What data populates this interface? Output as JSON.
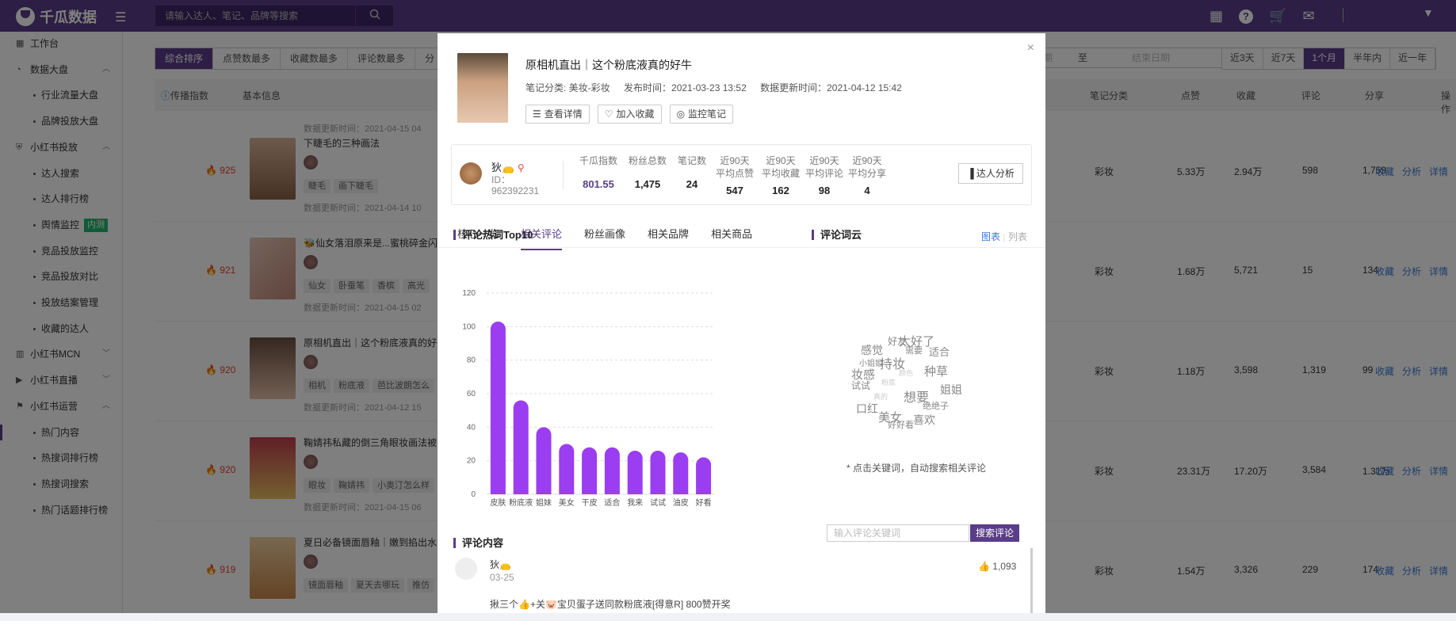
{
  "topbar": {
    "brand": "千瓜数据",
    "search_placeholder": "请输入达人、笔记、品牌等搜索"
  },
  "sidebar": {
    "items": [
      {
        "label": "工作台",
        "level": 1,
        "icon": "grid-icon"
      },
      {
        "label": "数据大盘",
        "level": 1,
        "icon": "pie-icon",
        "expanded": true
      },
      {
        "label": "行业流量大盘",
        "level": 2
      },
      {
        "label": "品牌投放大盘",
        "level": 2
      },
      {
        "label": "小红书投放",
        "level": 1,
        "icon": "shield-icon",
        "expanded": true
      },
      {
        "label": "达人搜索",
        "level": 2
      },
      {
        "label": "达人排行榜",
        "level": 2
      },
      {
        "label": "舆情监控",
        "level": 2,
        "badge": "内测"
      },
      {
        "label": "竞品投放监控",
        "level": 2
      },
      {
        "label": "竞品投放对比",
        "level": 2
      },
      {
        "label": "投放结案管理",
        "level": 2
      },
      {
        "label": "收藏的达人",
        "level": 2
      },
      {
        "label": "小红书MCN",
        "level": 1,
        "icon": "chart-icon",
        "expanded": false
      },
      {
        "label": "小红书直播",
        "level": 1,
        "icon": "video-icon",
        "expanded": false
      },
      {
        "label": "小红书运营",
        "level": 1,
        "icon": "bookmark-icon",
        "expanded": true
      },
      {
        "label": "热门内容",
        "level": 2,
        "active": true
      },
      {
        "label": "热搜词排行榜",
        "level": 2
      },
      {
        "label": "热搜词搜索",
        "level": 2
      },
      {
        "label": "热门话题排行榜",
        "level": 2
      }
    ]
  },
  "list": {
    "sort_tabs": [
      "综合排序",
      "点赞数最多",
      "收藏数最多",
      "评论数最多",
      "分"
    ],
    "date_start": "日期",
    "date_sep": "至",
    "date_end": "结束日期",
    "range_tabs": [
      "近3天",
      "近7天",
      "1个月",
      "半年内",
      "近一年"
    ],
    "headers": {
      "index": "传播指数",
      "info": "基本信息",
      "category": "笔记分类",
      "likes": "点赞",
      "collects": "收藏",
      "comments": "评论",
      "shares": "分享",
      "ops": "操作"
    },
    "top_update": "数据更新时间：2021-04-15 04",
    "rows": [
      {
        "hot": "925",
        "title": "下睫毛的三种画法",
        "tags": [
          "睫毛",
          "画下睫毛"
        ],
        "updated": "数据更新时间：2021-04-14 10",
        "category": "彩妆",
        "likes": "5.33万",
        "collects": "2.94万",
        "comments": "598",
        "shares": "1,759"
      },
      {
        "hot": "921",
        "title": "🐝仙女落泪原来是...蜜桃碎金闪",
        "tags": [
          "仙女",
          "卧蚕笔",
          "香槟",
          "高光"
        ],
        "updated": "数据更新时间：2021-04-15 02",
        "category": "彩妆",
        "likes": "1.68万",
        "collects": "5,721",
        "comments": "15",
        "shares": "134"
      },
      {
        "hot": "920",
        "title": "原相机直出｜这个粉底液真的好牛",
        "tags": [
          "相机",
          "粉底液",
          "芭比波朗怎么"
        ],
        "updated": "数据更新时间：2021-04-12 15",
        "category": "彩妆",
        "likes": "1.18万",
        "collects": "3,598",
        "comments": "1,319",
        "shares": "99"
      },
      {
        "hot": "920",
        "title": "鞠婧祎私藏的倒三角眼妆画法被",
        "tags": [
          "眼妆",
          "鞠婧祎",
          "小奥汀怎么样"
        ],
        "updated": "数据更新时间：2021-04-15 06",
        "category": "彩妆",
        "likes": "23.31万",
        "collects": "17.20万",
        "comments": "3,584",
        "shares": "1.31万"
      },
      {
        "hot": "919",
        "title": "夏日必备镜面唇釉｜嫩到掐出水",
        "tags": [
          "镜面唇釉",
          "夏天去哪玩",
          "推仿"
        ],
        "updated": "",
        "category": "彩妆",
        "likes": "1.54万",
        "collects": "3,326",
        "comments": "229",
        "shares": "174"
      }
    ],
    "ops": [
      "收藏",
      "分析",
      "详情"
    ]
  },
  "modal": {
    "title": "原相机直出｜这个粉底液真的好牛",
    "category": "笔记分类: 美妆-彩妆",
    "published": "发布时间：2021-03-23 13:52",
    "updated": "数据更新时间：2021-04-12 15:42",
    "buttons": {
      "detail": "查看详情",
      "collect": "加入收藏",
      "monitor": "监控笔记"
    },
    "kol": {
      "name": "狄👝",
      "id": "ID：962392231",
      "stats": [
        {
          "label": "千瓜指数",
          "value": "801.55"
        },
        {
          "label": "粉丝总数",
          "value": "1,475"
        },
        {
          "label": "笔记数",
          "value": "24"
        },
        {
          "label": "近90天\n平均点赞",
          "value": "547"
        },
        {
          "label": "近90天\n平均收藏",
          "value": "162"
        },
        {
          "label": "近90天\n平均评论",
          "value": "98"
        },
        {
          "label": "近90天\n平均分享",
          "value": "4"
        }
      ],
      "analyze_button": "达人分析"
    },
    "tabs": [
      "核心一览",
      "相关评论",
      "粉丝画像",
      "相关品牌",
      "相关商品"
    ],
    "active_tab": 1,
    "hotwords_title": "评论热词Top10",
    "cloud_title": "评论词云",
    "cloud_toggle": {
      "chart": "图表",
      "list": "列表"
    },
    "cloud_words": [
      "好友",
      "太好了",
      "感觉",
      "需要",
      "适合",
      "小姐姐",
      "持妆",
      "种草",
      "妆感",
      "试试",
      "姐姐",
      "想要",
      "口红",
      "绝绝子",
      "美女",
      "喜欢",
      "好好看",
      "粉底",
      "颜色",
      "真的"
    ],
    "cloud_note": "* 点击关键词，自动搜索相关评论",
    "comments_title": "评论内容",
    "comment_search_placeholder": "输入评论关键词",
    "comment_search_button": "搜索评论",
    "comment": {
      "name": "狄👝",
      "date": "03-25",
      "likes": "1,093",
      "text": "揪三个👍+关🐷宝贝蛋子送同款粉底液[得意R] 800赞开奖"
    }
  },
  "chart_data": {
    "type": "bar",
    "categories": [
      "皮肤",
      "粉底液",
      "姐妹",
      "美女",
      "干皮",
      "适合",
      "我来",
      "试试",
      "油皮",
      "好看"
    ],
    "values": [
      103,
      56,
      40,
      30,
      28,
      28,
      26,
      26,
      25,
      22
    ],
    "ylim": [
      0,
      120
    ],
    "yticks": [
      0,
      20,
      40,
      60,
      80,
      100,
      120
    ],
    "title": "评论热词Top10",
    "xlabel": "",
    "ylabel": "",
    "color": "#9b3df0",
    "grid": true
  }
}
